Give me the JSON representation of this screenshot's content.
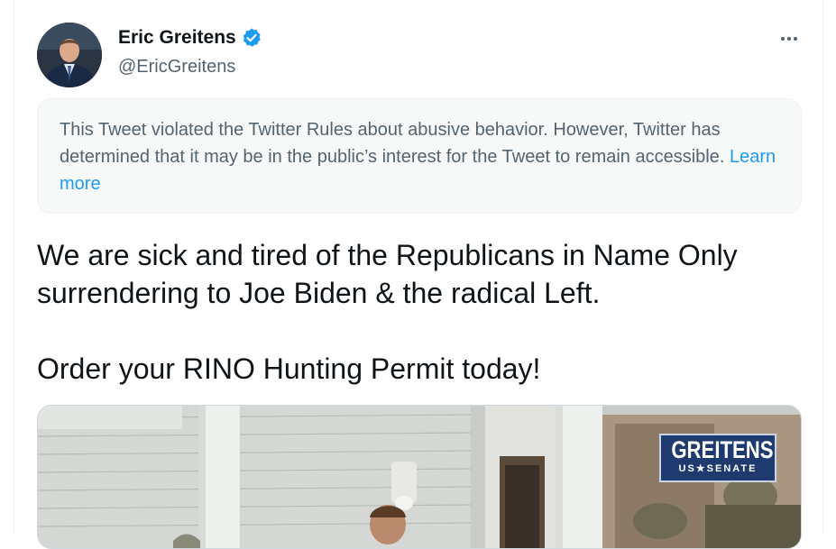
{
  "author": {
    "name": "Eric Greitens",
    "handle": "@EricGreitens"
  },
  "notice": {
    "text": "This Tweet violated the Twitter Rules about abusive behavior. However, Twitter has determined that it may be in the public’s interest for the Tweet to remain accessible.",
    "link_label": "Learn more"
  },
  "tweet": {
    "line1": "We are sick and tired of the Republicans in Name Only surrendering to Joe Biden & the radical Left.",
    "line2": "Order your RINO Hunting Permit today!"
  },
  "media": {
    "logo_main": "GREITENS",
    "logo_sub": "US★SENATE"
  },
  "colors": {
    "link": "#1d9bf0",
    "verified": "#1d9bf0",
    "text": "#0f1419",
    "secondary": "#536471"
  },
  "icons": {
    "verified": "verified-badge-icon",
    "more": "more-options-icon"
  }
}
